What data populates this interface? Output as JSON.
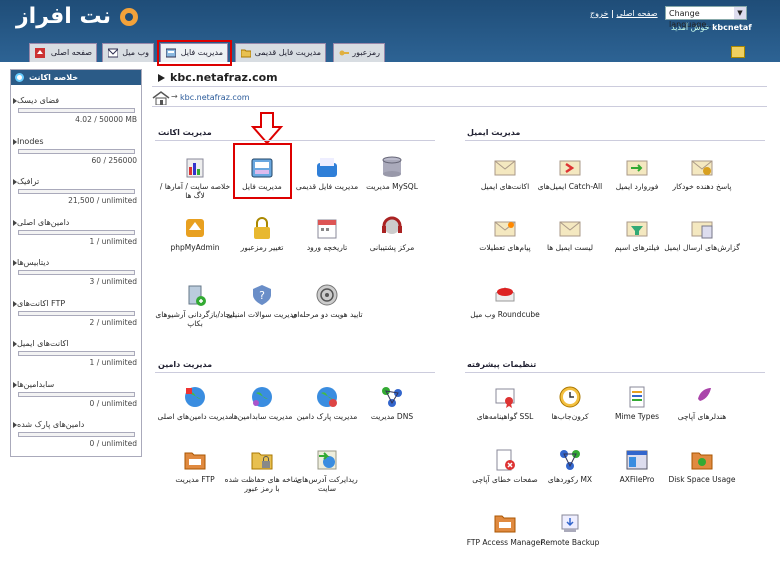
{
  "header": {
    "logo_text": "نت افراز",
    "toplinks_home": "صفحه اصلی",
    "toplinks_sep": "|",
    "toplinks_logout": "خروج",
    "language_label": "Change language...",
    "welcome_text": "خوش آمدید",
    "username": "kbcnetaf"
  },
  "tabs": [
    {
      "label": "صفحه اصلی"
    },
    {
      "label": "وب میل"
    },
    {
      "label": "مدیریت فایل"
    },
    {
      "label": "مدیریت فایل قدیمی"
    },
    {
      "label": "رمزعبور"
    }
  ],
  "sidebar": {
    "title": "خلاصه اکانت",
    "items": [
      {
        "label": "فضای دیسک",
        "value": "4.02 / 50000 MB"
      },
      {
        "label": "Inodes",
        "value": "60 / 256000"
      },
      {
        "label": "ترافیک",
        "value": "21,500 / unlimited"
      },
      {
        "label": "دامین‌های اصلی",
        "value": "1 / unlimited"
      },
      {
        "label": "دیتابیس‌ها",
        "value": "3 / unlimited"
      },
      {
        "label": "اکانت‌های FTP",
        "value": "2 / unlimited"
      },
      {
        "label": "اکانت‌های ایمیل",
        "value": "1 / unlimited"
      },
      {
        "label": "سابدامین‌ها",
        "value": "0 / unlimited"
      },
      {
        "label": "دامین‌های پارک شده",
        "value": "0 / unlimited"
      }
    ]
  },
  "main": {
    "title": "kbc.netafraz.com",
    "breadcrumb": "kbc.netafraz.com",
    "breadcrumb_sep": "→"
  },
  "sections": {
    "account": {
      "title": "مدیریت اکانت",
      "icons": [
        [
          "مدیریت MySQL",
          "مدیریت فایل قدیمی",
          "مدیریت فایل",
          "خلاصه سایت / آمارها / لاگ ها"
        ],
        [
          "مرکز پشتیبانی",
          "تاریخچه ورود",
          "تغییر رمزعبور",
          "phpMyAdmin"
        ],
        [
          "تایید هویت دو مرحله‌ای",
          "مدیریت سوالات امنیتی",
          "ایجاد/بازگردانی آرشیوهای بکاپ"
        ]
      ]
    },
    "email": {
      "title": "مدیریت ایمیل",
      "icons": [
        [
          "پاسخ دهنده خودکار",
          "فوروارد ایمیل",
          "ایمیل‌های Catch-All",
          "اکانت‌های ایمیل"
        ],
        [
          "گزارش‌های ارسال ایمیل",
          "فیلترهای اسپم",
          "لیست ایمیل ها",
          "پیام‌های تعطیلات"
        ],
        [
          "وب میل Roundcube"
        ]
      ]
    },
    "domain": {
      "title": "مدیریت دامین",
      "icons": [
        [
          "مدیریت DNS",
          "مدیریت پارک دامین",
          "مدیریت سابدامین‌ها",
          "مدیریت دامین‌های اصلی"
        ],
        [
          "ریدایرکت آدرس‌های سایت",
          "شاخه های حفاظت شده با رمز عبور",
          "مدیریت FTP"
        ]
      ]
    },
    "advanced": {
      "title": "تنظیمات پیشرفته",
      "icons": [
        [
          "هندلرهای آپاچی",
          "Mime Types",
          "کرون‌جاب‌ها",
          "گواهینامه‌های SSL"
        ],
        [
          "Disk Space Usage",
          "AXFilePro",
          "رکوردهای MX",
          "صفحات خطای آپاچی"
        ],
        [
          "Remote Backup",
          "FTP Access Manager"
        ]
      ]
    }
  },
  "colors": {
    "header_bg": "#2d6394",
    "highlight": "#dd0000"
  }
}
